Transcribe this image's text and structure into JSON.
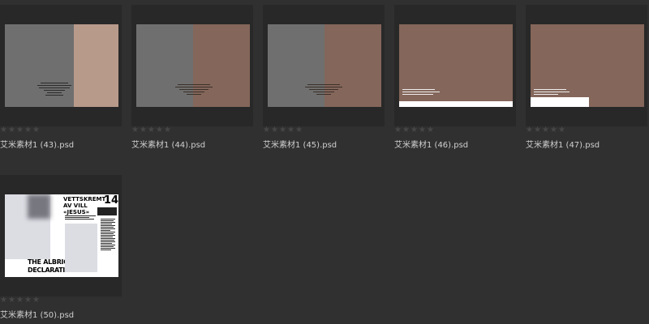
{
  "rating": {
    "max_stars": 5,
    "value": 0
  },
  "files": [
    {
      "name": "艾米素材1 (43).psd"
    },
    {
      "name": "艾米素材1 (44).psd"
    },
    {
      "name": "艾米素材1 (45).psd"
    },
    {
      "name": "艾米素材1 (46).psd"
    },
    {
      "name": "艾米素材1 (47).psd"
    },
    {
      "name": "艾米素材1 (50).psd"
    }
  ],
  "magazine": {
    "headline": "VETTSKREMT AV VILL «JESUS»",
    "number": "14",
    "bottom_line1": "THE ALBRIO",
    "bottom_line2": "DECLARATION"
  },
  "colors": {
    "background": "#303030",
    "tile": "#282828",
    "gray_block": "#6f6f6f",
    "brown": "#84665a",
    "peach": "#b89a8b"
  }
}
